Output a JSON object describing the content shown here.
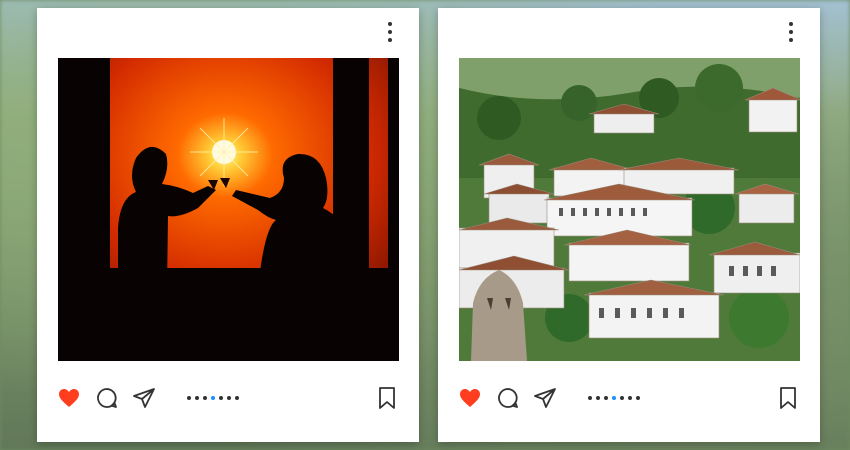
{
  "colors": {
    "like_red": "#ff3d1f",
    "active_dot": "#1e90ff",
    "icon_dark": "#333333",
    "card_bg": "#ffffff"
  },
  "posts": [
    {
      "image": "silhouette-couple-toasting-at-sunset",
      "liked": true,
      "carousel": {
        "count": 7,
        "active_index": 3
      },
      "icons": [
        "more-vertical-icon",
        "heart-icon",
        "comment-icon",
        "send-icon",
        "bookmark-icon"
      ]
    },
    {
      "image": "hillside-village-white-houses-red-roofs",
      "liked": true,
      "carousel": {
        "count": 7,
        "active_index": 3
      },
      "icons": [
        "more-vertical-icon",
        "heart-icon",
        "comment-icon",
        "send-icon",
        "bookmark-icon"
      ]
    }
  ]
}
